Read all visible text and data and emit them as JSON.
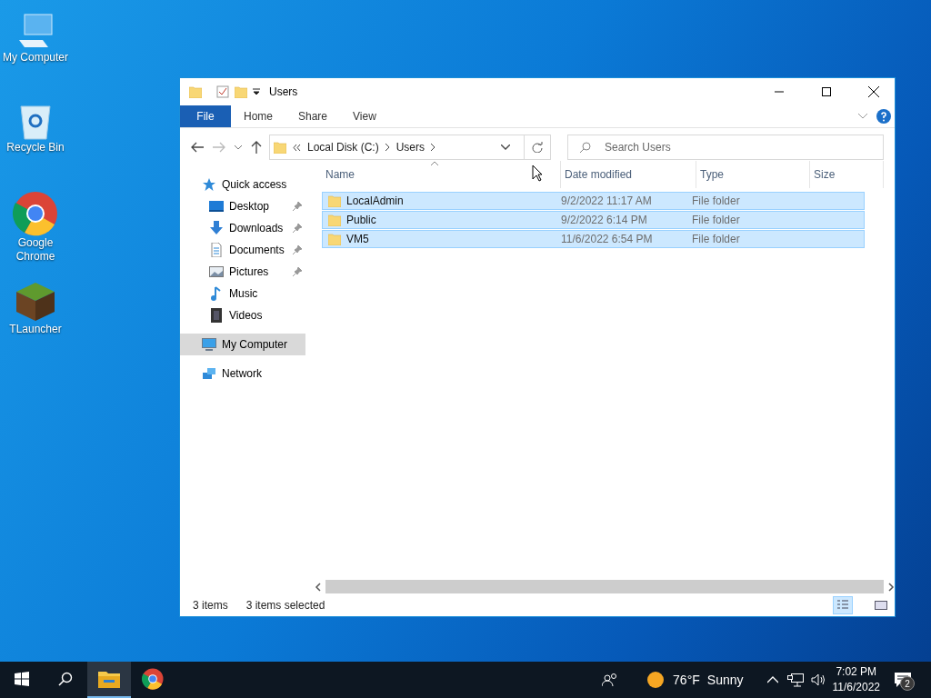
{
  "desktop_icons": [
    {
      "label": "My Computer",
      "kind": "computer"
    },
    {
      "label": "Recycle Bin",
      "kind": "bin"
    },
    {
      "label": "Google Chrome",
      "kind": "chrome"
    },
    {
      "label": "TLauncher",
      "kind": "block"
    }
  ],
  "window": {
    "title": "Users",
    "ribbon_tabs": [
      {
        "label": "File",
        "kind": "file"
      },
      {
        "label": "Home",
        "kind": "tab"
      },
      {
        "label": "Share",
        "kind": "tab"
      },
      {
        "label": "View",
        "kind": "tab"
      }
    ],
    "address": [
      "Local Disk (C:)",
      "Users"
    ],
    "search": {
      "placeholder": "Search Users"
    },
    "sidebar": {
      "items": [
        {
          "label": "Quick access",
          "kind": "star",
          "selected": false,
          "children": [
            {
              "label": "Desktop",
              "kind": "desktop",
              "pinned": true,
              "selected": false
            },
            {
              "label": "Downloads",
              "kind": "download",
              "pinned": true,
              "selected": false
            },
            {
              "label": "Documents",
              "kind": "document",
              "pinned": true,
              "selected": false
            },
            {
              "label": "Pictures",
              "kind": "picture",
              "pinned": true,
              "selected": false
            },
            {
              "label": "Music",
              "kind": "music",
              "pinned": false,
              "selected": false
            },
            {
              "label": "Videos",
              "kind": "video",
              "pinned": false,
              "selected": false
            }
          ]
        },
        {
          "label": "My Computer",
          "kind": "computer",
          "selected": true
        },
        {
          "label": "Network",
          "kind": "network",
          "selected": false
        }
      ]
    },
    "table": {
      "columns": [
        {
          "label": "Name",
          "sorted": true
        },
        {
          "label": "Date modified",
          "sorted": false
        },
        {
          "label": "Type",
          "sorted": false
        },
        {
          "label": "Size",
          "sorted": false
        }
      ],
      "rows": [
        {
          "name": "LocalAdmin",
          "date": "9/2/2022 11:17 AM",
          "type": "File folder",
          "selected": true
        },
        {
          "name": "Public",
          "date": "9/2/2022 6:14 PM",
          "type": "File folder",
          "selected": true
        },
        {
          "name": "VM5",
          "date": "11/6/2022 6:54 PM",
          "type": "File folder",
          "selected": true
        }
      ]
    },
    "status_bar": {
      "count": "3 items",
      "selection": "3 items selected",
      "views": [
        {
          "kind": "details",
          "selected": true
        },
        {
          "kind": "large",
          "selected": false
        }
      ]
    }
  },
  "taskbar": {
    "apps": [
      {
        "kind": "explorer",
        "active": true
      },
      {
        "kind": "chrome",
        "active": false
      }
    ],
    "temperature": "76°F",
    "weather": "Sunny",
    "time": "7:02 PM",
    "date": "11/6/2022",
    "notifications": "2"
  }
}
